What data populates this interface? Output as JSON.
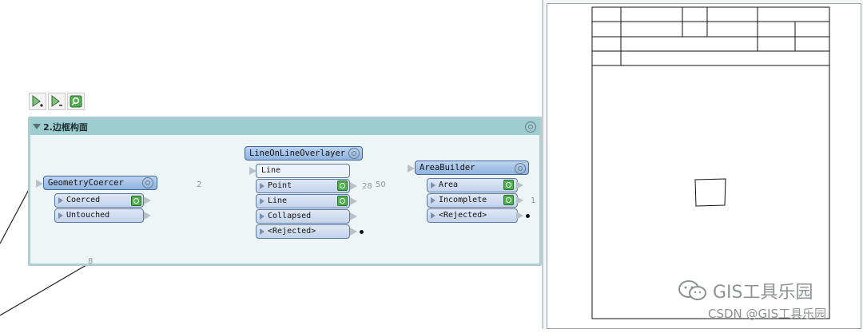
{
  "toolbar": {
    "buttons": [
      {
        "icon": "run-to-this-icon"
      },
      {
        "icon": "run-from-this-icon"
      },
      {
        "icon": "inspect-icon"
      }
    ]
  },
  "bookmark": {
    "title": "2.边框构面",
    "color": "#9dcdd0"
  },
  "transformers": {
    "geometry_coercer": {
      "title": "GeometryCoercer",
      "ports": [
        "Coerced",
        "Untouched"
      ]
    },
    "line_on_line": {
      "title": "LineOnLineOverlayer",
      "input": "Line",
      "ports": [
        "Point",
        "Line",
        "Collapsed",
        "<Rejected>"
      ]
    },
    "area_builder": {
      "title": "AreaBuilder",
      "ports": [
        "Area",
        "Incomplete",
        "<Rejected>"
      ]
    }
  },
  "counts": {
    "coerced_to_line": "2",
    "point_out": "28",
    "line_to_area": "50",
    "area_out": "1",
    "input_wire": "8"
  },
  "watermark": {
    "main": "GIS工具乐园",
    "sub": "CSDN @GIS工具乐园"
  }
}
